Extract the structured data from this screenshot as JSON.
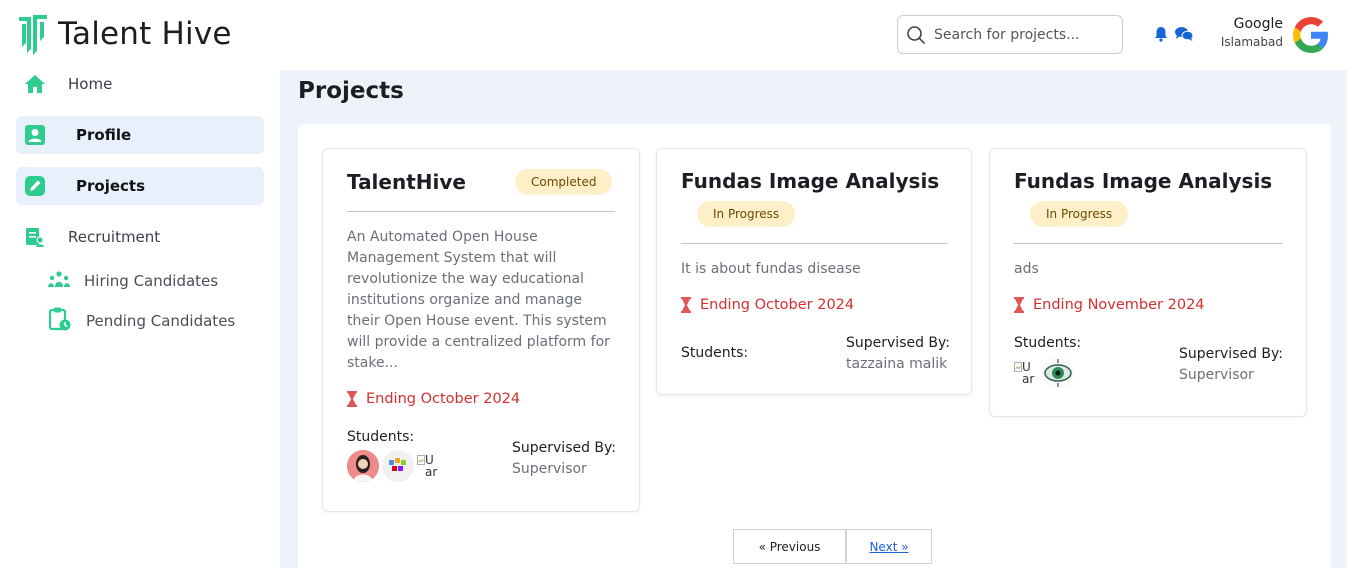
{
  "brand": {
    "name": "Talent Hive",
    "accent": "#2ecc8f"
  },
  "header": {
    "search_placeholder": "Search for projects...",
    "user_name": "Google",
    "user_location": "Islamabad"
  },
  "sidebar": {
    "items": [
      {
        "label": "Home",
        "icon": "home-icon"
      },
      {
        "label": "Profile",
        "icon": "profile-icon"
      },
      {
        "label": "Projects",
        "icon": "projects-icon"
      },
      {
        "label": "Recruitment",
        "icon": "recruitment-icon"
      }
    ],
    "sub_items": [
      {
        "label": "Hiring Candidates",
        "icon": "people-icon"
      },
      {
        "label": "Pending Candidates",
        "icon": "clipboard-clock-icon"
      }
    ]
  },
  "page": {
    "title": "Projects"
  },
  "projects": [
    {
      "title": "TalentHive",
      "status": "Completed",
      "description": "An Automated Open House Management System that will revolutionize the way educational institutions organize and manage their Open House event. This system will provide a centralized platform for stake...",
      "deadline": "Ending October 2024",
      "students_label": "Students:",
      "supervised_label": "Supervised By:",
      "supervisor": "Supervisor",
      "broken_img_alt": "U ar"
    },
    {
      "title": "Fundas Image Analysis",
      "status": "In Progress",
      "description": "It is about fundas disease",
      "deadline": "Ending October 2024",
      "students_label": "Students:",
      "supervised_label": "Supervised By:",
      "supervisor": "tazzaina malik"
    },
    {
      "title": "Fundas Image Analysis",
      "status": "In Progress",
      "description": "ads",
      "deadline": "Ending November 2024",
      "students_label": "Students:",
      "supervised_label": "Supervised By:",
      "supervisor": "Supervisor",
      "broken_img_alt": "U ar"
    }
  ],
  "pagination": {
    "prev": "« Previous",
    "next": "Next »"
  },
  "colors": {
    "badge_bg": "#fdefc8",
    "deadline": "#d32f2f",
    "main_bg": "#eef3fb",
    "active_nav": "#e8f0fc"
  }
}
